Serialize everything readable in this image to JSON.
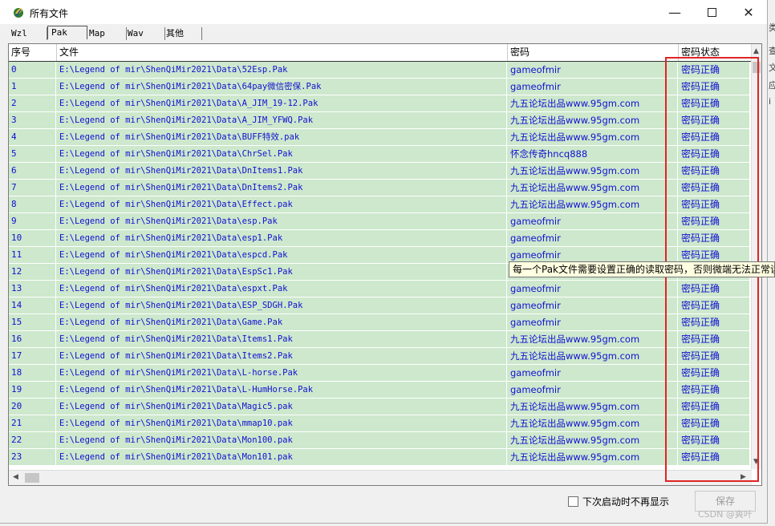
{
  "window": {
    "title": "所有文件"
  },
  "tabs": [
    {
      "label": "Wzl",
      "selected": false
    },
    {
      "label": "Pak",
      "selected": true
    },
    {
      "label": "Map",
      "selected": false
    },
    {
      "label": "Wav",
      "selected": false
    },
    {
      "label": "其他",
      "selected": false
    }
  ],
  "table": {
    "columns": {
      "index": "序号",
      "file": "文件",
      "password": "密码",
      "status": "密码状态"
    },
    "rows": [
      {
        "index": "0",
        "file": "E:\\Legend of mir\\ShenQiMir2021\\Data\\52Esp.Pak",
        "password": "gameofmir",
        "status": "密码正确"
      },
      {
        "index": "1",
        "file": "E:\\Legend of mir\\ShenQiMir2021\\Data\\64pay微信密保.Pak",
        "password": "gameofmir",
        "status": "密码正确"
      },
      {
        "index": "2",
        "file": "E:\\Legend of mir\\ShenQiMir2021\\Data\\A_JIM_19-12.Pak",
        "password": "九五论坛出品www.95gm.com",
        "status": "密码正确"
      },
      {
        "index": "3",
        "file": "E:\\Legend of mir\\ShenQiMir2021\\Data\\A_JIM_YFWQ.Pak",
        "password": "九五论坛出品www.95gm.com",
        "status": "密码正确"
      },
      {
        "index": "4",
        "file": "E:\\Legend of mir\\ShenQiMir2021\\Data\\BUFF特效.pak",
        "password": "九五论坛出品www.95gm.com",
        "status": "密码正确"
      },
      {
        "index": "5",
        "file": "E:\\Legend of mir\\ShenQiMir2021\\Data\\ChrSel.Pak",
        "password": "怀念传奇hncq888",
        "status": "密码正确"
      },
      {
        "index": "6",
        "file": "E:\\Legend of mir\\ShenQiMir2021\\Data\\DnItems1.Pak",
        "password": "九五论坛出品www.95gm.com",
        "status": "密码正确"
      },
      {
        "index": "7",
        "file": "E:\\Legend of mir\\ShenQiMir2021\\Data\\DnItems2.Pak",
        "password": "九五论坛出品www.95gm.com",
        "status": "密码正确"
      },
      {
        "index": "8",
        "file": "E:\\Legend of mir\\ShenQiMir2021\\Data\\Effect.pak",
        "password": "九五论坛出品www.95gm.com",
        "status": "密码正确"
      },
      {
        "index": "9",
        "file": "E:\\Legend of mir\\ShenQiMir2021\\Data\\esp.Pak",
        "password": "gameofmir",
        "status": "密码正确"
      },
      {
        "index": "10",
        "file": "E:\\Legend of mir\\ShenQiMir2021\\Data\\esp1.Pak",
        "password": "gameofmir",
        "status": "密码正确"
      },
      {
        "index": "11",
        "file": "E:\\Legend of mir\\ShenQiMir2021\\Data\\espcd.Pak",
        "password": "gameofmir",
        "status": "密码正确"
      },
      {
        "index": "12",
        "file": "E:\\Legend of mir\\ShenQiMir2021\\Data\\EspSc1.Pak",
        "password": "",
        "status": ""
      },
      {
        "index": "13",
        "file": "E:\\Legend of mir\\ShenQiMir2021\\Data\\espxt.Pak",
        "password": "gameofmir",
        "status": "密码正确"
      },
      {
        "index": "14",
        "file": "E:\\Legend of mir\\ShenQiMir2021\\Data\\ESP_SDGH.Pak",
        "password": "gameofmir",
        "status": "密码正确"
      },
      {
        "index": "15",
        "file": "E:\\Legend of mir\\ShenQiMir2021\\Data\\Game.Pak",
        "password": "gameofmir",
        "status": "密码正确"
      },
      {
        "index": "16",
        "file": "E:\\Legend of mir\\ShenQiMir2021\\Data\\Items1.Pak",
        "password": "九五论坛出品www.95gm.com",
        "status": "密码正确"
      },
      {
        "index": "17",
        "file": "E:\\Legend of mir\\ShenQiMir2021\\Data\\Items2.Pak",
        "password": "九五论坛出品www.95gm.com",
        "status": "密码正确"
      },
      {
        "index": "18",
        "file": "E:\\Legend of mir\\ShenQiMir2021\\Data\\L-horse.Pak",
        "password": "gameofmir",
        "status": "密码正确"
      },
      {
        "index": "19",
        "file": "E:\\Legend of mir\\ShenQiMir2021\\Data\\L-HumHorse.Pak",
        "password": "gameofmir",
        "status": "密码正确"
      },
      {
        "index": "20",
        "file": "E:\\Legend of mir\\ShenQiMir2021\\Data\\Magic5.pak",
        "password": "九五论坛出品www.95gm.com",
        "status": "密码正确"
      },
      {
        "index": "21",
        "file": "E:\\Legend of mir\\ShenQiMir2021\\Data\\mmap10.pak",
        "password": "九五论坛出品www.95gm.com",
        "status": "密码正确"
      },
      {
        "index": "22",
        "file": "E:\\Legend of mir\\ShenQiMir2021\\Data\\Mon100.pak",
        "password": "九五论坛出品www.95gm.com",
        "status": "密码正确"
      },
      {
        "index": "23",
        "file": "E:\\Legend of mir\\ShenQiMir2021\\Data\\Mon101.pak",
        "password": "九五论坛出品www.95gm.com",
        "status": "密码正确"
      }
    ]
  },
  "tooltip": {
    "text": "每一个Pak文件需要设置正确的读取密码，否则微端无法正常读"
  },
  "footer": {
    "checkbox_label": "下次启动时不再显示",
    "checkbox_checked": false,
    "save_label": "保存"
  },
  "watermark": "CSDN @爽叶",
  "side_text": [
    "类",
    "查",
    "文",
    "应",
    "i"
  ],
  "colors": {
    "row_bg": "#cde8cd",
    "row_text": "#1010d0",
    "highlight": "#e02424",
    "tooltip_bg": "#ffffe1"
  },
  "icons": {
    "app": "app-leaf-icon",
    "minimize": "minimize-icon",
    "maximize": "maximize-icon",
    "close": "close-icon"
  }
}
